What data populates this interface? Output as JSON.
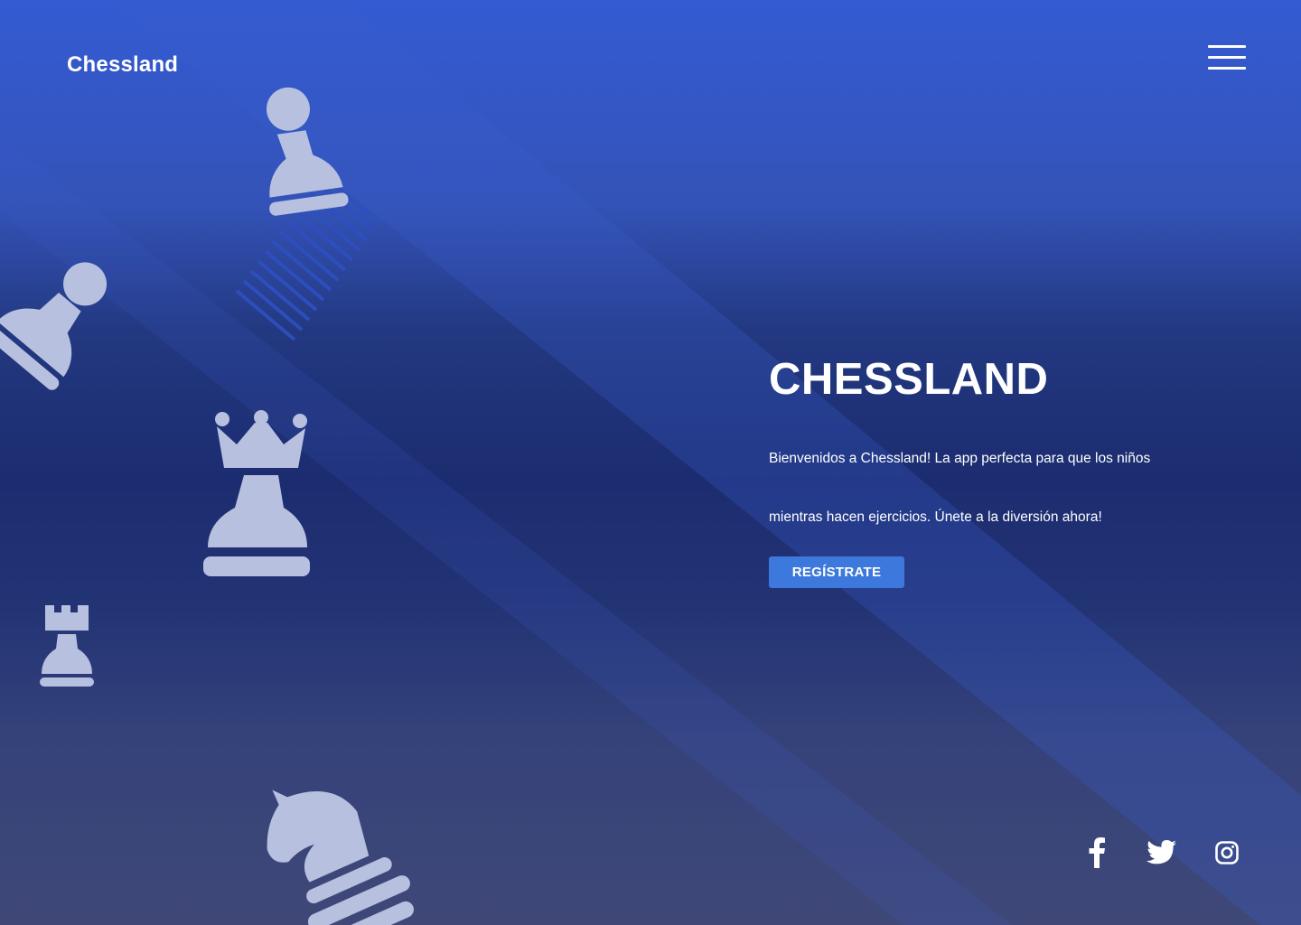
{
  "header": {
    "logo_text": "Chessland",
    "menu_icon": "hamburger-menu-icon"
  },
  "hero": {
    "title": "CHESSLAND",
    "description_line_1": "Bienvenidos a Chessland! La app perfecta para que los niños",
    "description_line_2": "mientras hacen ejercicios. Únete a la diversión ahora!",
    "cta_label": "REGÍSTRATE"
  },
  "decorations": {
    "pieces": [
      "pawn-icon",
      "pawn-icon",
      "queen-icon",
      "rook-icon",
      "knight-icon"
    ],
    "piece_color": "#b8c0e0"
  },
  "social": {
    "links": [
      "facebook-icon",
      "twitter-icon",
      "instagram-icon"
    ]
  },
  "colors": {
    "background_top": "#345bd3",
    "background_mid": "#1c2c70",
    "background_bottom": "#3f4877",
    "button": "#3d79dc",
    "text": "#ffffff"
  }
}
